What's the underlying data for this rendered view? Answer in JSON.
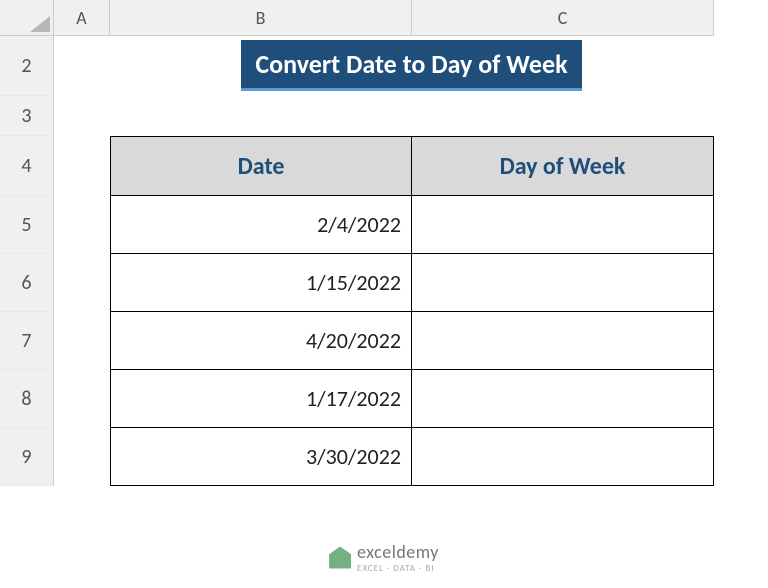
{
  "columns": {
    "A": "A",
    "B": "B",
    "C": "C"
  },
  "rows": {
    "r2": "2",
    "r3": "3",
    "r4": "4",
    "r5": "5",
    "r6": "6",
    "r7": "7",
    "r8": "8",
    "r9": "9"
  },
  "title": "Convert Date to Day of Week",
  "headers": {
    "date": "Date",
    "dayOfWeek": "Day of Week"
  },
  "data": {
    "dates": [
      "2/4/2022",
      "1/15/2022",
      "4/20/2022",
      "1/17/2022",
      "3/30/2022"
    ],
    "daysOfWeek": [
      "",
      "",
      "",
      "",
      ""
    ]
  },
  "watermark": {
    "name": "exceldemy",
    "tagline": "EXCEL · DATA · BI"
  }
}
